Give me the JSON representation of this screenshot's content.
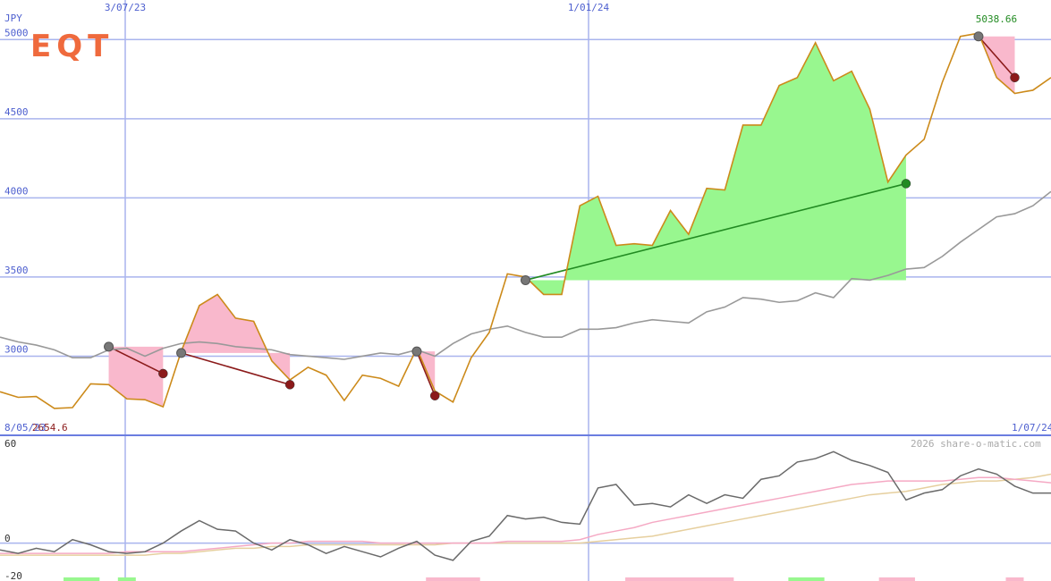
{
  "chart_data": [
    {
      "type": "line",
      "logo": "EQT",
      "unit_label": "JPY",
      "y_ticks": [
        3000,
        3500,
        4000,
        4500,
        5000
      ],
      "ylim": [
        2500,
        5250
      ],
      "top_date_labels": [
        "3/07/23",
        "1/01/24"
      ],
      "bottom_date_labels": [
        "8/05/23",
        "1/07/24"
      ],
      "high_label": "5038.66",
      "low_label": "2654.6",
      "credit": "2026 share-o-matic.com",
      "colors": {
        "price": "#cc8a1a",
        "average": "#999999",
        "grid": "#a9b4ee",
        "gain": "#98f78f",
        "loss": "#f9b8cc",
        "up_trade": "#228b22",
        "down_trade": "#8b1a1a",
        "label_blue": "#4d5fcf",
        "label_green": "#228b22",
        "label_red": "#8b1a1a",
        "logo": "#ef6a3d"
      },
      "series": [
        {
          "values": [
            2775,
            2740,
            2745,
            2670,
            2675,
            2825,
            2820,
            2730,
            2725,
            2680,
            3030,
            3320,
            3390,
            3240,
            3220,
            2970,
            2850,
            2930,
            2880,
            2720,
            2880,
            2860,
            2810,
            3050,
            2780,
            2710,
            2990,
            3150,
            3520,
            3500,
            3390,
            3390,
            3950,
            4010,
            3700,
            3710,
            3700,
            3920,
            3770,
            4060,
            4050,
            4460,
            4460,
            4710,
            4760,
            4980,
            4740,
            4800,
            4560,
            4100,
            4270,
            4370,
            4730,
            5020,
            5040,
            4760,
            4660,
            4680,
            4760
          ]
        },
        {
          "values": [
            3120,
            3090,
            3070,
            3040,
            2990,
            2990,
            3040,
            3050,
            3000,
            3050,
            3080,
            3090,
            3080,
            3060,
            3050,
            3040,
            3010,
            3000,
            2990,
            2980,
            3000,
            3020,
            3010,
            3040,
            3000,
            3080,
            3140,
            3170,
            3190,
            3150,
            3120,
            3120,
            3170,
            3170,
            3180,
            3210,
            3230,
            3220,
            3210,
            3280,
            3310,
            3370,
            3360,
            3340,
            3350,
            3400,
            3370,
            3490,
            3480,
            3510,
            3550,
            3560,
            3630,
            3720,
            3800,
            3880,
            3900,
            3950,
            4040
          ]
        }
      ],
      "trades": [
        {
          "entry": 3060,
          "exit": 2890,
          "result": "loss"
        },
        {
          "entry": 3020,
          "exit": 2820,
          "result": "loss"
        },
        {
          "entry": 3030,
          "exit": 2750,
          "result": "loss"
        },
        {
          "entry": 3480,
          "exit": 4090,
          "result": "gain"
        },
        {
          "entry": 5020,
          "exit": 4760,
          "result": "loss"
        }
      ]
    },
    {
      "type": "line",
      "y_ticks": [
        60,
        0,
        -20
      ],
      "ylim": [
        -22,
        62
      ],
      "colors": {
        "osc1": "#6a6a6a",
        "osc2": "#f5a9c4",
        "osc3": "#e6cf9e",
        "bar_up": "#98f78f",
        "bar_down": "#f9b8cc"
      },
      "series": [
        {
          "values": [
            -4,
            -6,
            -3,
            -5,
            2,
            -1,
            -5,
            -6,
            -5,
            0,
            7,
            13,
            8,
            7,
            0,
            -4,
            2,
            -1,
            -6,
            -2,
            -5,
            -8,
            -3,
            1,
            -7,
            -10,
            1,
            4,
            16,
            14,
            15,
            12,
            11,
            32,
            34,
            22,
            23,
            21,
            28,
            23,
            28,
            26,
            37,
            39,
            47,
            49,
            53,
            48,
            45,
            41,
            25,
            29,
            31,
            39,
            43,
            40,
            33,
            29,
            29
          ]
        },
        {
          "values": [
            -6,
            -6,
            -6,
            -6,
            -6,
            -6,
            -6,
            -5,
            -5,
            -5,
            -5,
            -4,
            -3,
            -2,
            -1,
            0,
            0,
            1,
            1,
            1,
            1,
            0,
            0,
            0,
            0,
            0,
            0,
            0,
            1,
            1,
            1,
            1,
            2,
            5,
            7,
            9,
            12,
            14,
            16,
            18,
            20,
            22,
            24,
            26,
            28,
            30,
            32,
            34,
            35,
            36,
            36,
            36,
            36,
            37,
            38,
            38,
            37,
            36,
            35
          ]
        },
        {
          "values": [
            -7,
            -7,
            -7,
            -7,
            -7,
            -7,
            -7,
            -7,
            -7,
            -6,
            -6,
            -5,
            -4,
            -3,
            -3,
            -2,
            -2,
            -1,
            -1,
            -1,
            -1,
            -1,
            -1,
            -1,
            -1,
            0,
            0,
            0,
            0,
            0,
            0,
            0,
            0,
            1,
            2,
            3,
            4,
            6,
            8,
            10,
            12,
            14,
            16,
            18,
            20,
            22,
            24,
            26,
            28,
            29,
            30,
            32,
            34,
            35,
            36,
            36,
            37,
            38,
            40
          ]
        }
      ],
      "bars": [
        {
          "from": 4,
          "to": 5,
          "kind": "up"
        },
        {
          "from": 7,
          "to": 7,
          "kind": "up"
        },
        {
          "from": 24,
          "to": 26,
          "kind": "down"
        },
        {
          "from": 35,
          "to": 40,
          "kind": "down"
        },
        {
          "from": 44,
          "to": 45,
          "kind": "up"
        },
        {
          "from": 49,
          "to": 50,
          "kind": "down"
        },
        {
          "from": 56,
          "to": 56,
          "kind": "down"
        }
      ]
    }
  ]
}
